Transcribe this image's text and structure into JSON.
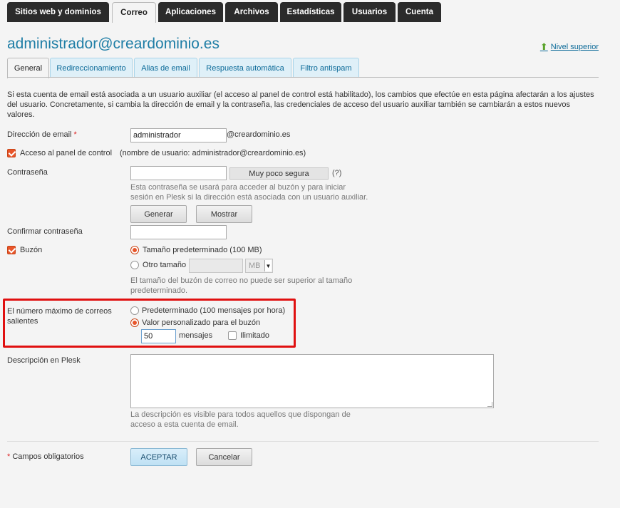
{
  "nav": {
    "tabs": [
      {
        "label": "Sitios web y dominios"
      },
      {
        "label": "Correo"
      },
      {
        "label": "Aplicaciones"
      },
      {
        "label": "Archivos"
      },
      {
        "label": "Estadísticas"
      },
      {
        "label": "Usuarios"
      },
      {
        "label": "Cuenta"
      }
    ],
    "active": "Correo"
  },
  "page": {
    "title": "administrador@creardominio.es",
    "up_link": "Nivel superior"
  },
  "subtabs": [
    {
      "label": "General"
    },
    {
      "label": "Redireccionamiento"
    },
    {
      "label": "Alias de email"
    },
    {
      "label": "Respuesta automática"
    },
    {
      "label": "Filtro antispam"
    }
  ],
  "intro": "Si esta cuenta de email está asociada a un usuario auxiliar (el acceso al panel de control está habilitado), los cambios que efectúe en esta página afectarán a los ajustes del usuario. Concretamente, si cambia la dirección de email y la contraseña, las credenciales de acceso del usuario auxiliar también se cambiarán a estos nuevos valores.",
  "form": {
    "email_label": "Dirección de email",
    "required_mark": "*",
    "email_value": "administrador",
    "email_domain": "@creardominio.es",
    "panel_access_label": "Acceso al panel de control",
    "panel_access_note": "(nombre de usuario: administrador@creardominio.es)",
    "password_label": "Contraseña",
    "password_strength": "Muy poco segura",
    "password_help": "(?)",
    "password_hint_1": "Esta contraseña se usará para acceder al buzón y para iniciar",
    "password_hint_2": "sesión en Plesk si la dirección está asociada con un usuario auxiliar.",
    "generate_btn": "Generar",
    "show_btn": "Mostrar",
    "confirm_label": "Confirmar contraseña",
    "mailbox_label": "Buzón",
    "mailbox_default": "Tamaño predeterminado (100 MB)",
    "mailbox_other": "Otro tamaño",
    "mailbox_unit": "MB",
    "mailbox_hint_1": "El tamaño del buzón de correo no puede ser superior al tamaño",
    "mailbox_hint_2": "predeterminado.",
    "max_out_label_1": "El número máximo de correos",
    "max_out_label_2": "salientes",
    "max_out_default": "Predeterminado (100 mensajes por hora)",
    "max_out_custom": "Valor personalizado para el buzón",
    "max_out_value": "50",
    "max_out_unit": "mensajes",
    "max_out_unlimited": "Ilimitado",
    "desc_label": "Descripción en Plesk",
    "desc_hint_1": "La descripción es visible para todos aquellos que dispongan de",
    "desc_hint_2": "acceso a esta cuenta de email.",
    "required_note": "Campos obligatorios",
    "ok_btn": "ACEPTAR",
    "cancel_btn": "Cancelar"
  },
  "colors": {
    "accent": "#1f7ea6",
    "check": "#e8552a",
    "highlight": "#e01010"
  }
}
